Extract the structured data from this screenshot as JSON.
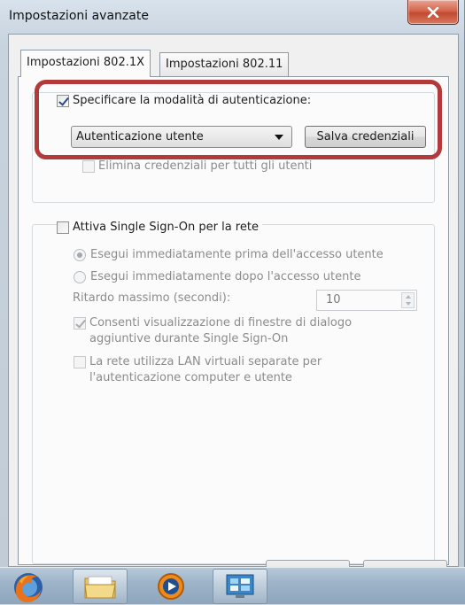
{
  "window": {
    "title": "Impostazioni avanzate",
    "close_label": "x"
  },
  "tabs": [
    {
      "label": "Impostazioni 802.1X",
      "active": true
    },
    {
      "label": "Impostazioni 802.11",
      "active": false
    }
  ],
  "auth": {
    "specify_mode_label": "Specificare la modalità di autenticazione:",
    "specify_mode_checked": true,
    "mode_selected": "Autenticazione utente",
    "save_credentials_label": "Salva credenziali",
    "delete_credentials_label": "Elimina credenziali per tutti gli utenti",
    "delete_credentials_checked": false
  },
  "sso": {
    "enable_label": "Attiva Single Sign-On per la rete",
    "enable_checked": false,
    "radio_before_label": "Esegui immediatamente prima dell'accesso utente",
    "radio_after_label": "Esegui immediatamente dopo l'accesso utente",
    "max_delay_label": "Ritardo massimo (secondi):",
    "max_delay_value": "10",
    "allow_dialogs_line1": "Consenti visualizzazione di finestre di dialogo",
    "allow_dialogs_line2": "aggiuntive durante Single Sign-On",
    "allow_dialogs_checked": true,
    "separate_vlan_line1": "La rete utilizza LAN virtuali separate per",
    "separate_vlan_line2": "l'autenticazione computer e utente",
    "separate_vlan_checked": false
  },
  "taskbar": {
    "items": [
      "firefox-icon",
      "folder-icon",
      "media-player-icon",
      "control-panel-icon"
    ]
  },
  "colors": {
    "highlight": "#b33a3a",
    "close_button": "#c9503a"
  }
}
